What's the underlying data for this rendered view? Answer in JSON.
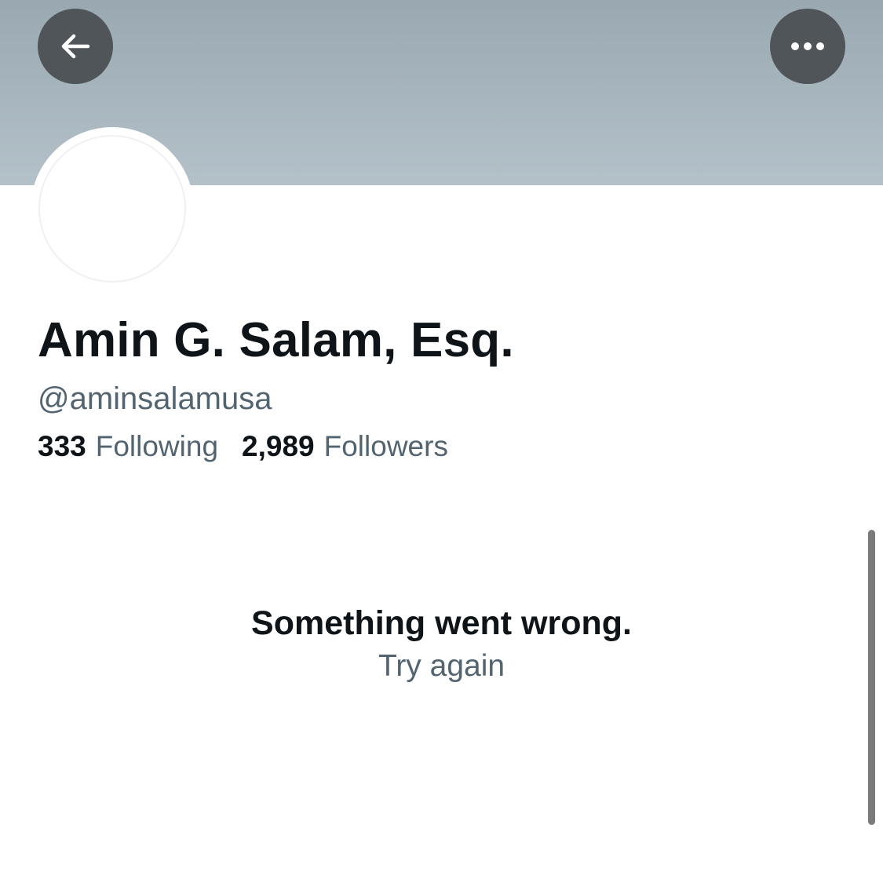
{
  "profile": {
    "display_name": "Amin G. Salam, Esq.",
    "handle": "@aminsalamusa",
    "following_count": "333",
    "following_label": "Following",
    "followers_count": "2,989",
    "followers_label": "Followers"
  },
  "error": {
    "title": "Something went wrong.",
    "retry_label": "Try again"
  },
  "icons": {
    "back": "arrow-left-icon",
    "more": "more-horizontal-icon"
  },
  "colors": {
    "banner_top": "#9aa8b1",
    "banner_bottom": "#b4c1c9",
    "button_bg": "#4f5559",
    "primary_text": "#0f1419",
    "secondary_text": "#536471"
  }
}
